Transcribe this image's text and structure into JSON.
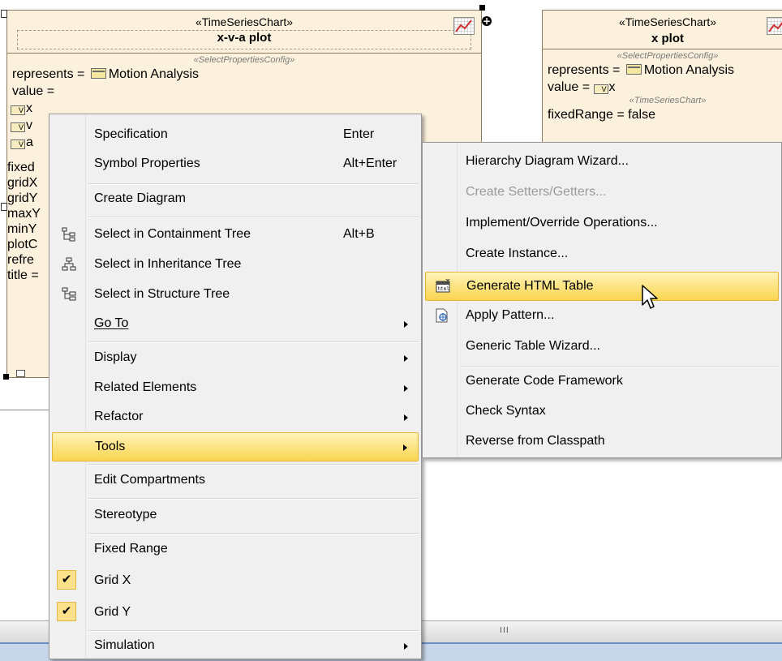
{
  "diagram": {
    "left_shape": {
      "stereotype": "«TimeSeriesChart»",
      "name": "x-v-a plot",
      "config_stereotype": "«SelectPropertiesConfig»",
      "represents_label": "represents =",
      "represents_value": "Motion Analysis",
      "value_label": "value =",
      "values": [
        "x",
        "v",
        "a"
      ],
      "partial_props": [
        "fixed",
        "gridX",
        "gridY",
        "maxY",
        "minY",
        "plotC",
        "refre",
        "title ="
      ]
    },
    "right_shape": {
      "stereotype": "«TimeSeriesChart»",
      "name": "x plot",
      "config_stereotype": "«SelectPropertiesConfig»",
      "represents_label": "represents =",
      "represents_value": "Motion Analysis",
      "value_label": "value =",
      "value_item": "x",
      "chart_stereotype": "«TimeSeriesChart»",
      "fixed_range": "fixedRange = false"
    }
  },
  "context_menu": {
    "items": [
      {
        "label": "Specification",
        "accel": "Enter"
      },
      {
        "label": "Symbol Properties",
        "accel": "Alt+Enter"
      },
      {
        "label": "Create Diagram"
      },
      {
        "label": "Select in Containment Tree",
        "accel": "Alt+B",
        "icon": "containment-tree-icon"
      },
      {
        "label": "Select in Inheritance Tree",
        "icon": "inheritance-tree-icon"
      },
      {
        "label": "Select in Structure Tree",
        "icon": "structure-tree-icon"
      },
      {
        "label": "Go To",
        "submenu": true
      },
      {
        "label": "Display",
        "submenu": true
      },
      {
        "label": "Related Elements",
        "submenu": true
      },
      {
        "label": "Refactor",
        "submenu": true
      },
      {
        "label": "Tools",
        "submenu": true,
        "highlighted": true
      },
      {
        "label": "Edit Compartments"
      },
      {
        "label": "Stereotype"
      },
      {
        "label": "Fixed Range"
      },
      {
        "label": "Grid X",
        "checked": true
      },
      {
        "label": "Grid Y",
        "checked": true
      },
      {
        "label": "Simulation",
        "submenu": true
      }
    ]
  },
  "tools_submenu": {
    "items": [
      {
        "label": "Hierarchy Diagram Wizard..."
      },
      {
        "label": "Create Setters/Getters...",
        "disabled": true
      },
      {
        "label": "Implement/Override Operations..."
      },
      {
        "label": "Create Instance..."
      },
      {
        "label": "Generate HTML Table",
        "highlighted": true,
        "icon": "html-table-icon"
      },
      {
        "label": "Apply Pattern...",
        "icon": "pattern-icon"
      },
      {
        "label": "Generic Table Wizard..."
      },
      {
        "label": "Generate Code Framework"
      },
      {
        "label": "Check Syntax"
      },
      {
        "label": "Reverse from Classpath"
      }
    ]
  },
  "scrollbar": {
    "grip": "III"
  },
  "colors": {
    "shape_fill": "#fbf1dc",
    "menu_bg": "#f0f0f0",
    "highlight": "#f9d54e"
  }
}
